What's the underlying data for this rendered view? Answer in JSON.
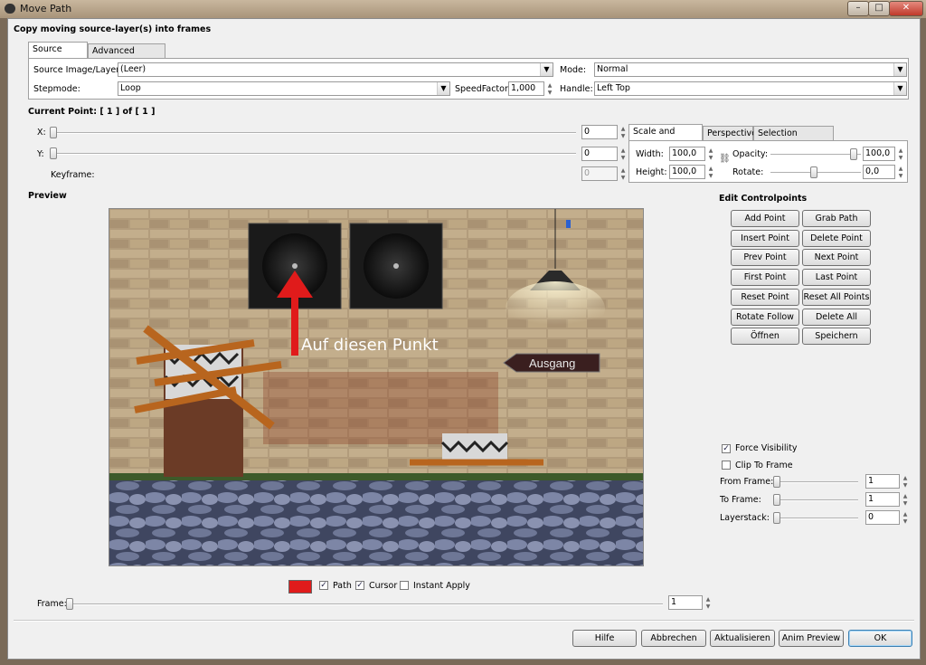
{
  "window": {
    "title": "Move Path",
    "caption_buttons": [
      "–",
      "□",
      "✕"
    ]
  },
  "header": {
    "title": "Copy moving source-layer(s) into frames"
  },
  "tabs_top": [
    {
      "label": "Source Select",
      "active": true
    },
    {
      "label": "Advanced Settings",
      "active": false
    }
  ],
  "source": {
    "image_label": "Source Image/Layer:",
    "image_value": "(Leer)",
    "mode_label": "Mode:",
    "mode_value": "Normal",
    "stepmode_label": "Stepmode:",
    "stepmode_value": "Loop",
    "speed_label": "SpeedFactor:",
    "speed_value": "1,000",
    "handle_label": "Handle:",
    "handle_value": "Left  Top"
  },
  "current_point": {
    "label": "Current Point: [   1 ] of [   1 ]",
    "x_label": "X:",
    "x_value": "0",
    "y_label": "Y:",
    "y_value": "0",
    "keyframe_label": "Keyframe:",
    "keyframe_value": "0"
  },
  "tabs_right": [
    {
      "label": "Scale and Modify",
      "active": true
    },
    {
      "label": "Perspective",
      "active": false
    },
    {
      "label": "Selection Handling",
      "active": false
    }
  ],
  "scale": {
    "width_label": "Width:",
    "width_value": "100,0",
    "height_label": "Height:",
    "height_value": "100,0",
    "opacity_label": "Opacity:",
    "opacity_value": "100,0",
    "rotate_label": "Rotate:",
    "rotate_value": "0,0"
  },
  "preview": {
    "label": "Preview",
    "annotation": "Auf diesen Punkt",
    "sign_text": "Ausgang",
    "path_color": "#e01b1b"
  },
  "controlpoints": {
    "title": "Edit Controlpoints",
    "buttons": [
      [
        "Add Point",
        "Grab Path"
      ],
      [
        "Insert Point",
        "Delete Point"
      ],
      [
        "Prev Point",
        "Next Point"
      ],
      [
        "First Point",
        "Last Point"
      ],
      [
        "Reset Point",
        "Reset All Points"
      ],
      [
        "Rotate Follow",
        "Delete All Points"
      ],
      [
        "Öffnen",
        "Speichern"
      ]
    ]
  },
  "visibility": {
    "force_label": "Force Visibility",
    "force_checked": true,
    "clip_label": "Clip To Frame",
    "clip_checked": false,
    "from_label": "From Frame:",
    "from_value": "1",
    "to_label": "To Frame:",
    "to_value": "1",
    "layer_label": "Layerstack:",
    "layer_value": "0"
  },
  "preview_options": {
    "path_label": "Path",
    "path_checked": true,
    "cursor_label": "Cursor",
    "cursor_checked": true,
    "instant_label": "Instant Apply",
    "instant_checked": false
  },
  "frame": {
    "label": "Frame:",
    "value": "1"
  },
  "footer": {
    "help": "Hilfe",
    "cancel": "Abbrechen",
    "refresh": "Aktualisieren",
    "anim": "Anim Preview",
    "ok": "OK"
  },
  "colors": {
    "accent": "#3c7fb1",
    "path_red": "#e01b1b"
  }
}
